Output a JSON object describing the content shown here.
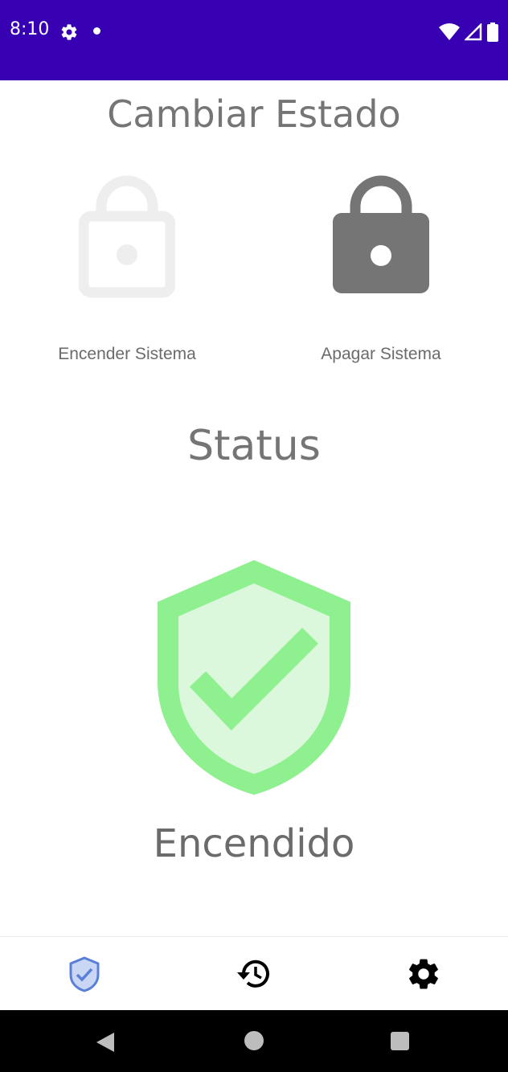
{
  "status_bar": {
    "time": "8:10",
    "background": "#3700b3",
    "icons": [
      "settings-icon",
      "notification-dot-icon",
      "wifi-icon",
      "signal-icon",
      "battery-icon"
    ]
  },
  "control": {
    "title": "Cambiar Estado",
    "on_button": {
      "label": "Encender Sistema",
      "icon": "lock-open-icon",
      "active": false
    },
    "off_button": {
      "label": "Apagar Sistema",
      "icon": "lock-closed-icon",
      "active": true
    }
  },
  "status": {
    "title": "Status",
    "value": "Encendido",
    "icon": "shield-check-icon",
    "color": "#8ef08f"
  },
  "bottom_nav": {
    "items": [
      {
        "id": "status",
        "icon": "shield-check-icon",
        "selected": true
      },
      {
        "id": "history",
        "icon": "history-icon",
        "selected": false
      },
      {
        "id": "settings",
        "icon": "gear-icon",
        "selected": false
      }
    ]
  },
  "system_nav": {
    "buttons": [
      "back",
      "home",
      "recents"
    ]
  }
}
